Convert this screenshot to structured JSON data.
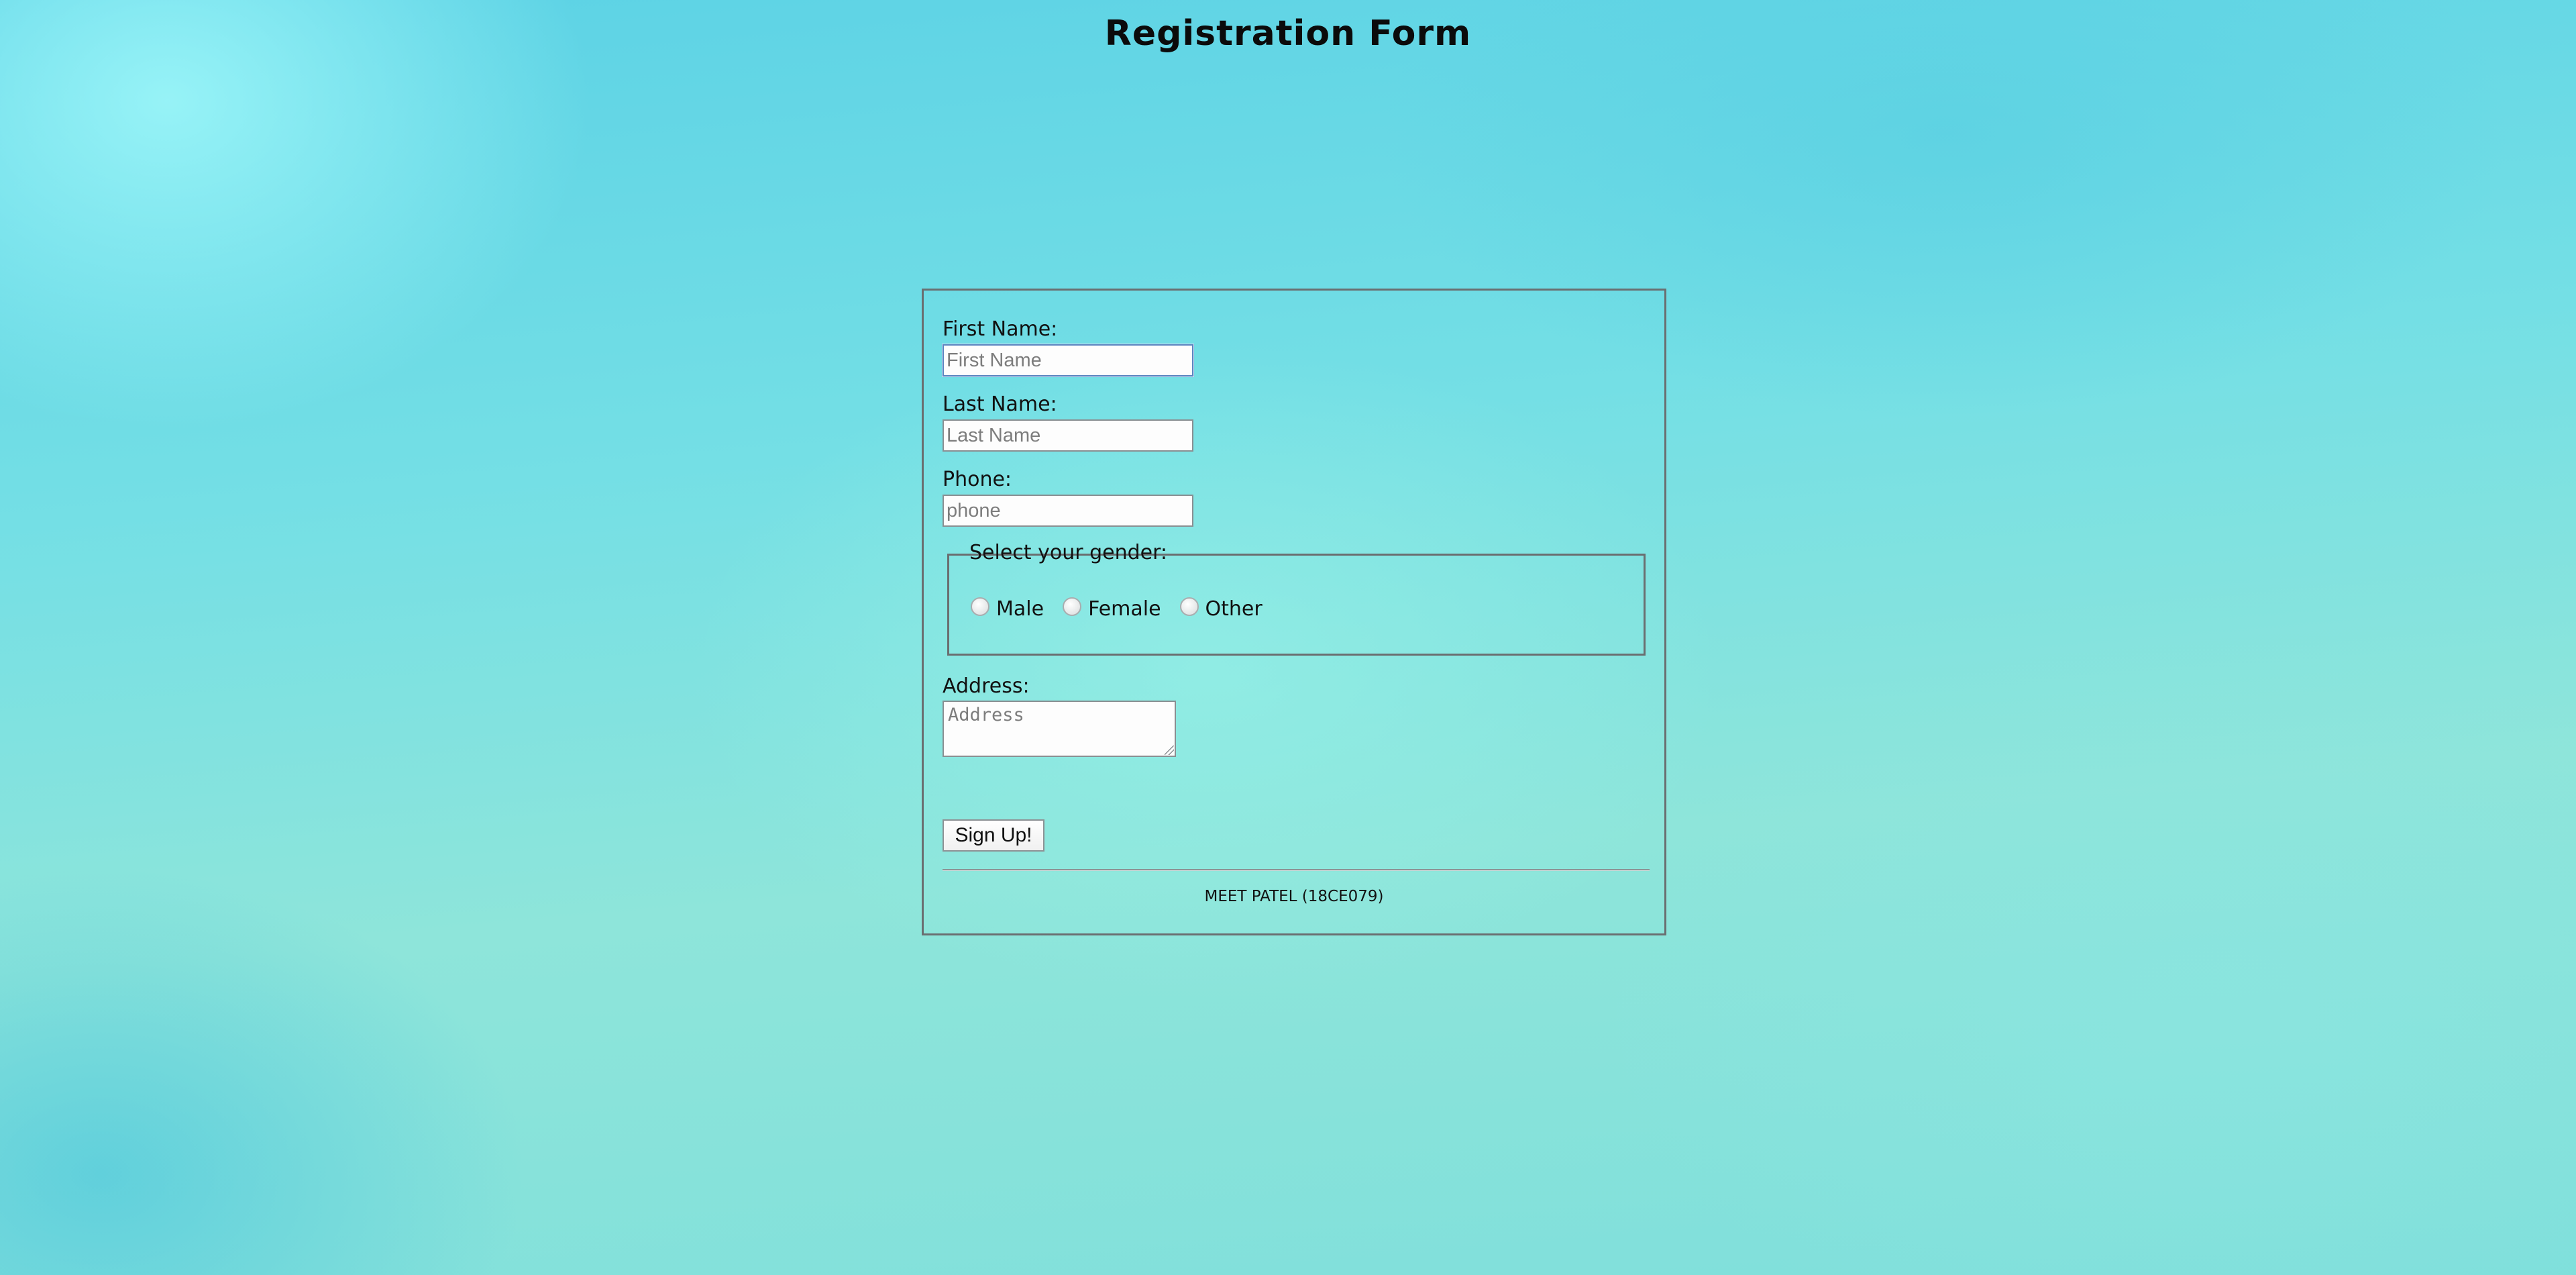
{
  "page": {
    "title": "Registration Form"
  },
  "form": {
    "first_name": {
      "label": "First Name:",
      "placeholder": "First Name",
      "value": ""
    },
    "last_name": {
      "label": "Last Name:",
      "placeholder": "Last Name",
      "value": ""
    },
    "phone": {
      "label": "Phone:",
      "placeholder": "phone",
      "value": ""
    },
    "gender": {
      "legend": "Select your gender:",
      "options": [
        "Male",
        "Female",
        "Other"
      ],
      "selected": null
    },
    "address": {
      "label": "Address:",
      "placeholder": "Address",
      "value": ""
    },
    "submit_label": "Sign Up!",
    "footer_text": "MEET PATEL (18CE079)"
  },
  "colors": {
    "border": "#6a6e70",
    "input_focus_border": "#5b86c0",
    "background_primary": "#5cd2e5",
    "background_secondary": "#8ee5da"
  }
}
